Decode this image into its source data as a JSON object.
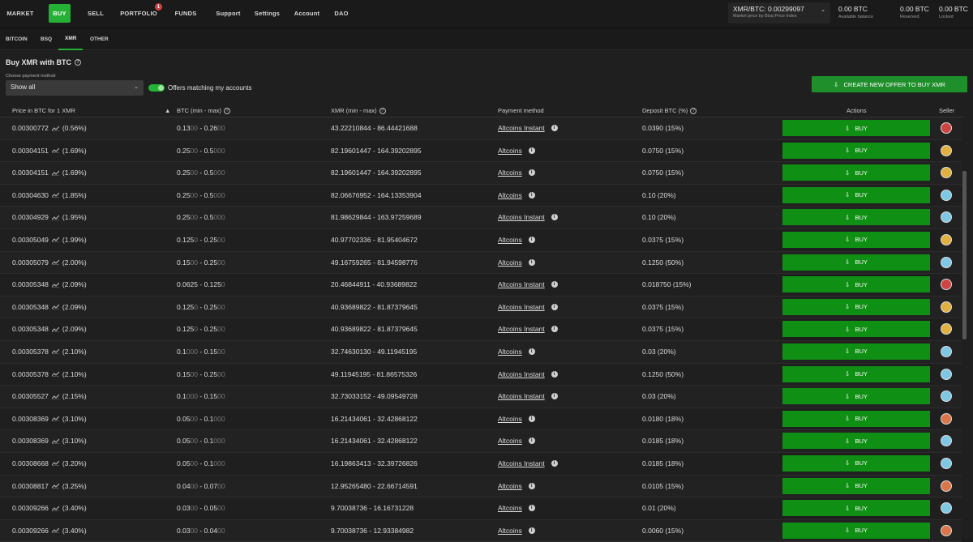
{
  "topnav": {
    "items": [
      "MARKET",
      "BUY",
      "SELL",
      "PORTFOLIO",
      "FUNDS",
      "Support",
      "Settings",
      "Account",
      "DAO"
    ],
    "active": "BUY",
    "portfolio_badge": "1"
  },
  "market_price": {
    "value": "XMR/BTC: 0.00299097",
    "label": "Market price by Bisq Price Index"
  },
  "balances": [
    {
      "value": "0.00 BTC",
      "label": "Available balance"
    },
    {
      "value": "0.00 BTC",
      "label": "Reserved"
    },
    {
      "value": "0.00 BTC",
      "label": "Locked"
    }
  ],
  "subtabs": [
    "BITCOIN",
    "BSQ",
    "XMR",
    "OTHER"
  ],
  "page": {
    "title": "Buy XMR with BTC",
    "payment_label": "Choose payment method",
    "payment_value": "Show all",
    "toggle_label": "Offers matching my accounts",
    "create_button": "CREATE NEW OFFER TO BUY XMR"
  },
  "columns": {
    "price": "Price in BTC for 1 XMR",
    "btc": "BTC (min - max)",
    "xmr": "XMR (min - max)",
    "payment": "Payment method",
    "deposit": "Deposit BTC (%)",
    "actions": "Actions",
    "seller": "Seller"
  },
  "buy_label": "BUY",
  "colors": {
    "accent": "#25b135",
    "buy": "#0f8f14"
  },
  "rows": [
    {
      "price": "0.00300772",
      "pct": "(0.56%)",
      "btc_min": "0.13",
      "btc_min_dim": "00",
      "btc_max": "0.26",
      "btc_max_dim": "00",
      "xmr": "43.22210844 - 86.44421688",
      "method": "Altcoins Instant",
      "deposit": "0.0390 (15%)",
      "avatar": "#c44"
    },
    {
      "price": "0.00304151",
      "pct": "(1.69%)",
      "btc_min": "0.25",
      "btc_min_dim": "00",
      "btc_max": "0.5",
      "btc_max_dim": "000",
      "xmr": "82.19601447 - 164.39202895",
      "method": "Altcoins",
      "deposit": "0.0750 (15%)",
      "avatar": "#e0b040"
    },
    {
      "price": "0.00304151",
      "pct": "(1.69%)",
      "btc_min": "0.25",
      "btc_min_dim": "00",
      "btc_max": "0.5",
      "btc_max_dim": "000",
      "xmr": "82.19601447 - 164.39202895",
      "method": "Altcoins",
      "deposit": "0.0750 (15%)",
      "avatar": "#e0b040"
    },
    {
      "price": "0.00304630",
      "pct": "(1.85%)",
      "btc_min": "0.25",
      "btc_min_dim": "00",
      "btc_max": "0.5",
      "btc_max_dim": "000",
      "xmr": "82.06676952 - 164.13353904",
      "method": "Altcoins",
      "deposit": "0.10 (20%)",
      "avatar": "#7ec8e3"
    },
    {
      "price": "0.00304929",
      "pct": "(1.95%)",
      "btc_min": "0.25",
      "btc_min_dim": "00",
      "btc_max": "0.5",
      "btc_max_dim": "000",
      "xmr": "81.98629844 - 163.97259689",
      "method": "Altcoins Instant",
      "deposit": "0.10 (20%)",
      "avatar": "#7ec8e3"
    },
    {
      "price": "0.00305049",
      "pct": "(1.99%)",
      "btc_min": "0.125",
      "btc_min_dim": "0",
      "btc_max": "0.25",
      "btc_max_dim": "00",
      "xmr": "40.97702336 - 81.95404672",
      "method": "Altcoins",
      "deposit": "0.0375 (15%)",
      "avatar": "#e0b040"
    },
    {
      "price": "0.00305079",
      "pct": "(2.00%)",
      "btc_min": "0.15",
      "btc_min_dim": "00",
      "btc_max": "0.25",
      "btc_max_dim": "00",
      "xmr": "49.16759265 - 81.94598776",
      "method": "Altcoins",
      "deposit": "0.1250 (50%)",
      "avatar": "#7ec8e3"
    },
    {
      "price": "0.00305348",
      "pct": "(2.09%)",
      "btc_min": "0.0625",
      "btc_min_dim": "",
      "btc_max": "0.125",
      "btc_max_dim": "0",
      "xmr": "20.46844911 - 40.93689822",
      "method": "Altcoins Instant",
      "deposit": "0.018750 (15%)",
      "avatar": "#c44"
    },
    {
      "price": "0.00305348",
      "pct": "(2.09%)",
      "btc_min": "0.125",
      "btc_min_dim": "0",
      "btc_max": "0.25",
      "btc_max_dim": "00",
      "xmr": "40.93689822 - 81.87379645",
      "method": "Altcoins Instant",
      "deposit": "0.0375 (15%)",
      "avatar": "#e0b040"
    },
    {
      "price": "0.00305348",
      "pct": "(2.09%)",
      "btc_min": "0.125",
      "btc_min_dim": "0",
      "btc_max": "0.25",
      "btc_max_dim": "00",
      "xmr": "40.93689822 - 81.87379645",
      "method": "Altcoins Instant",
      "deposit": "0.0375 (15%)",
      "avatar": "#e0b040"
    },
    {
      "price": "0.00305378",
      "pct": "(2.10%)",
      "btc_min": "0.1",
      "btc_min_dim": "000",
      "btc_max": "0.15",
      "btc_max_dim": "00",
      "xmr": "32.74630130 - 49.11945195",
      "xmr_dim": true,
      "method": "Altcoins",
      "deposit": "0.03 (20%)",
      "avatar": "#7ec8e3"
    },
    {
      "price": "0.00305378",
      "pct": "(2.10%)",
      "btc_min": "0.15",
      "btc_min_dim": "00",
      "btc_max": "0.25",
      "btc_max_dim": "00",
      "xmr": "49.11945195 - 81.86575326",
      "method": "Altcoins Instant",
      "deposit": "0.1250 (50%)",
      "avatar": "#7ec8e3"
    },
    {
      "price": "0.00305527",
      "pct": "(2.15%)",
      "btc_min": "0.1",
      "btc_min_dim": "000",
      "btc_max": "0.15",
      "btc_max_dim": "00",
      "xmr": "32.73033152 - 49.09549728",
      "method": "Altcoins Instant",
      "deposit": "0.03 (20%)",
      "avatar": "#7ec8e3"
    },
    {
      "price": "0.00308369",
      "pct": "(3.10%)",
      "btc_min": "0.05",
      "btc_min_dim": "00",
      "btc_max": "0.1",
      "btc_max_dim": "000",
      "xmr": "16.21434061 - 32.42868122",
      "method": "Altcoins",
      "deposit": "0.0180 (18%)",
      "avatar": "#d9774a"
    },
    {
      "price": "0.00308369",
      "pct": "(3.10%)",
      "btc_min": "0.05",
      "btc_min_dim": "00",
      "btc_max": "0.1",
      "btc_max_dim": "000",
      "xmr": "16.21434061 - 32.42868122",
      "method": "Altcoins",
      "deposit": "0.0185 (18%)",
      "avatar": "#7ec8e3"
    },
    {
      "price": "0.00308668",
      "pct": "(3.20%)",
      "btc_min": "0.05",
      "btc_min_dim": "00",
      "btc_max": "0.1",
      "btc_max_dim": "000",
      "xmr": "16.19863413 - 32.39726826",
      "method": "Altcoins Instant",
      "deposit": "0.0185 (18%)",
      "avatar": "#7ec8e3"
    },
    {
      "price": "0.00308817",
      "pct": "(3.25%)",
      "btc_min": "0.04",
      "btc_min_dim": "00",
      "btc_max": "0.07",
      "btc_max_dim": "00",
      "xmr": "12.95265480 - 22.66714591",
      "method": "Altcoins",
      "deposit": "0.0105 (15%)",
      "avatar": "#d9774a"
    },
    {
      "price": "0.00309266",
      "pct": "(3.40%)",
      "btc_min": "0.03",
      "btc_min_dim": "00",
      "btc_max": "0.05",
      "btc_max_dim": "00",
      "xmr": "9.70038736 - 16.16731228",
      "method": "Altcoins",
      "deposit": "0.01 (20%)",
      "avatar": "#7ec8e3"
    },
    {
      "price": "0.00309266",
      "pct": "(3.40%)",
      "btc_min": "0.03",
      "btc_min_dim": "00",
      "btc_max": "0.04",
      "btc_max_dim": "00",
      "xmr": "9.70038736 - 12.93384982",
      "method": "Altcoins",
      "deposit": "0.0060 (15%)",
      "avatar": "#d9774a"
    }
  ]
}
